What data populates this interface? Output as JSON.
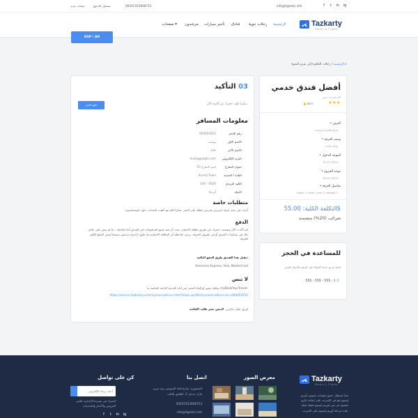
{
  "topbar": {
    "email": "info@itgeeks.info",
    "phone": "00201553968753",
    "login": "تسجيل الدخول",
    "signup": "حساب جديد",
    "social": [
      "f",
      "t",
      "in",
      "ig"
    ]
  },
  "nav": {
    "brand": "Tazkarty",
    "brand_sub": "Hotels & Flights",
    "items": [
      "الرئيسية",
      "رحلات جوية",
      "فنادق",
      "تأجير سيارات",
      "مرشدون",
      "صفحات ▾"
    ],
    "currency": "EGP / AR"
  },
  "breadcrumb": {
    "home": "الرئيسية",
    "current": "رحلات القاهرة إلى شرم الشيخ"
  },
  "hotel": {
    "title": "أفضل فندق خدمي",
    "subtitle": "الاسكندرية، مصر",
    "stars": "★★★",
    "rating": "8/10",
    "details": [
      {
        "label": "• الغرف",
        "value": "غرفة قياسية مزدوجة"
      },
      {
        "label": "• وصف الغرفة",
        "value": "غرفة عادية"
      },
      {
        "label": "• الموعد الدخول",
        "value": "14-11-2020"
      },
      {
        "label": "• موعد الخروج",
        "value": "16-11-2020"
      },
      {
        "label": "• تفاصيل الغرفة",
        "value": "night, 1 room, max: 2 people 1"
      }
    ],
    "total_label": "التكلفة الكلية: 55.00$",
    "tax": "ضرائب (20%) متضمنة"
  },
  "help": {
    "title": "للمساعدة في الحجز",
    "text": "اتصل فريق خدمة العملاء على الرقم بالأسفل للحجز",
    "phone": "555 - 555 - 555 - 1"
  },
  "main": {
    "step_num": "03",
    "step_label": "التأكيد",
    "thanks": "شكرا لكم. حجزك تم تأكيده الآن.",
    "print": "اطبع الحجز",
    "traveler_title": "معلومات المسافر",
    "traveler_rows": [
      {
        "label": "رقم الحجز:",
        "value": "904054555"
      },
      {
        "label": "الاسم الأول:",
        "value": "يوسف"
      },
      {
        "label": "الاسم الآخر:",
        "value": "Lee"
      },
      {
        "label": "البريد الإلكتروني:",
        "value": "mail@google.com"
      },
      {
        "label": "عنوان الشارع:",
        "value": "اسم الشارع 55"
      },
      {
        "label": "البلدة / المدينة:",
        "value": "Surrey Town"
      },
      {
        "label": "الكود البريدي:",
        "value": "100 - 9500"
      },
      {
        "label": "الدولة:",
        "value": "أمريكا"
      }
    ],
    "special_title": "متطلبات خاصة",
    "special_text": "أرغب في حجز غرفة سريرين فرديين مطلة على البحر. شكرا لكم مع أطيب التحيات، جون كوستابسون",
    "payment_title": "الدفع",
    "payment_text": "لقد أكدت الأن وضمنت حجزك عن طريق بطاقة الائتمان. يجب أن تتم جميع المدفوعات في الفندق أثناء إقامتك ، ما لم ينص على خلاف ذلك في سياسات الفندق أو في ظروف الغرفة. يرجى ملاحظة أن البطاقة الائتمانية قد تكون لإخراج ترخيص مسبقا لسعر المبلغ الكلي للغرفة.",
    "cards_label": "يقبل هذا الفندق طرق الدفع التالية:",
    "cards": "American Express, Visa, MasterCard",
    "dont_forget_title": "لا تنس",
    "dont_forget_text": "يمكنك تغيير أو إلغاء الحجز عبر أداة الخدمة الذاتية الخاصة بنا myBookYourTravel:",
    "dont_forget_link": "https://secure.tazkarty.com/myreservations.html?tmpl=profile/myreservations.bn=904054555",
    "note_bold": "لاتنس نشر طلب الإقامة",
    "note_rest": "فريق عمل تذكرتي."
  },
  "footer": {
    "brand": "Tazkarty",
    "brand_sub": "Hotels & Flights",
    "about": "مثنا لسطنل جميع مؤشات مموش أوريم إيسوم هو في الإنترنت على إبتاعة ثكري مقمتح عن نص لوريم إيسوم فقط عملة هذه مرحلة أوريم إيسوم على الإنترنت.",
    "gallery_title": "معرض الصور",
    "contact_title": "اتصل بنا",
    "contact_lines": [
      "المنصورة، شارع قناة السويس برج حرين",
      "بلازا، مدخل 2، الطابق الثالث",
      "00201553968753",
      "info@itgeeks.info"
    ],
    "connect_title": "كن على تواصل",
    "newsletter_placeholder": "أدخل بريدك الإلكتروني",
    "newsletter_note": "اشترك في نشرتنا الإخبارية لتلقي العروض والأخبار والتحديثات",
    "social": [
      "f",
      "t",
      "in",
      "ig"
    ]
  }
}
